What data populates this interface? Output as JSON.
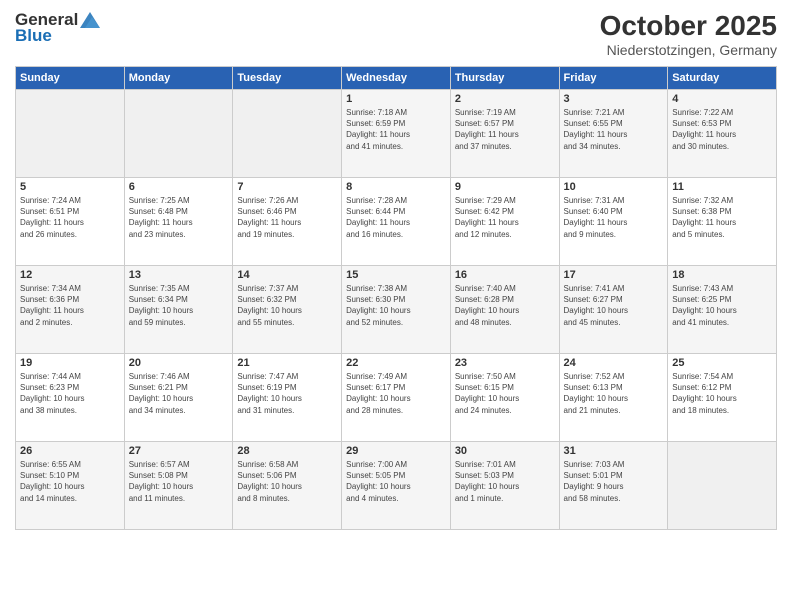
{
  "header": {
    "logo_general": "General",
    "logo_blue": "Blue",
    "month_title": "October 2025",
    "location": "Niederstotzingen, Germany"
  },
  "weekdays": [
    "Sunday",
    "Monday",
    "Tuesday",
    "Wednesday",
    "Thursday",
    "Friday",
    "Saturday"
  ],
  "weeks": [
    [
      {
        "day": "",
        "info": ""
      },
      {
        "day": "",
        "info": ""
      },
      {
        "day": "",
        "info": ""
      },
      {
        "day": "1",
        "info": "Sunrise: 7:18 AM\nSunset: 6:59 PM\nDaylight: 11 hours\nand 41 minutes."
      },
      {
        "day": "2",
        "info": "Sunrise: 7:19 AM\nSunset: 6:57 PM\nDaylight: 11 hours\nand 37 minutes."
      },
      {
        "day": "3",
        "info": "Sunrise: 7:21 AM\nSunset: 6:55 PM\nDaylight: 11 hours\nand 34 minutes."
      },
      {
        "day": "4",
        "info": "Sunrise: 7:22 AM\nSunset: 6:53 PM\nDaylight: 11 hours\nand 30 minutes."
      }
    ],
    [
      {
        "day": "5",
        "info": "Sunrise: 7:24 AM\nSunset: 6:51 PM\nDaylight: 11 hours\nand 26 minutes."
      },
      {
        "day": "6",
        "info": "Sunrise: 7:25 AM\nSunset: 6:48 PM\nDaylight: 11 hours\nand 23 minutes."
      },
      {
        "day": "7",
        "info": "Sunrise: 7:26 AM\nSunset: 6:46 PM\nDaylight: 11 hours\nand 19 minutes."
      },
      {
        "day": "8",
        "info": "Sunrise: 7:28 AM\nSunset: 6:44 PM\nDaylight: 11 hours\nand 16 minutes."
      },
      {
        "day": "9",
        "info": "Sunrise: 7:29 AM\nSunset: 6:42 PM\nDaylight: 11 hours\nand 12 minutes."
      },
      {
        "day": "10",
        "info": "Sunrise: 7:31 AM\nSunset: 6:40 PM\nDaylight: 11 hours\nand 9 minutes."
      },
      {
        "day": "11",
        "info": "Sunrise: 7:32 AM\nSunset: 6:38 PM\nDaylight: 11 hours\nand 5 minutes."
      }
    ],
    [
      {
        "day": "12",
        "info": "Sunrise: 7:34 AM\nSunset: 6:36 PM\nDaylight: 11 hours\nand 2 minutes."
      },
      {
        "day": "13",
        "info": "Sunrise: 7:35 AM\nSunset: 6:34 PM\nDaylight: 10 hours\nand 59 minutes."
      },
      {
        "day": "14",
        "info": "Sunrise: 7:37 AM\nSunset: 6:32 PM\nDaylight: 10 hours\nand 55 minutes."
      },
      {
        "day": "15",
        "info": "Sunrise: 7:38 AM\nSunset: 6:30 PM\nDaylight: 10 hours\nand 52 minutes."
      },
      {
        "day": "16",
        "info": "Sunrise: 7:40 AM\nSunset: 6:28 PM\nDaylight: 10 hours\nand 48 minutes."
      },
      {
        "day": "17",
        "info": "Sunrise: 7:41 AM\nSunset: 6:27 PM\nDaylight: 10 hours\nand 45 minutes."
      },
      {
        "day": "18",
        "info": "Sunrise: 7:43 AM\nSunset: 6:25 PM\nDaylight: 10 hours\nand 41 minutes."
      }
    ],
    [
      {
        "day": "19",
        "info": "Sunrise: 7:44 AM\nSunset: 6:23 PM\nDaylight: 10 hours\nand 38 minutes."
      },
      {
        "day": "20",
        "info": "Sunrise: 7:46 AM\nSunset: 6:21 PM\nDaylight: 10 hours\nand 34 minutes."
      },
      {
        "day": "21",
        "info": "Sunrise: 7:47 AM\nSunset: 6:19 PM\nDaylight: 10 hours\nand 31 minutes."
      },
      {
        "day": "22",
        "info": "Sunrise: 7:49 AM\nSunset: 6:17 PM\nDaylight: 10 hours\nand 28 minutes."
      },
      {
        "day": "23",
        "info": "Sunrise: 7:50 AM\nSunset: 6:15 PM\nDaylight: 10 hours\nand 24 minutes."
      },
      {
        "day": "24",
        "info": "Sunrise: 7:52 AM\nSunset: 6:13 PM\nDaylight: 10 hours\nand 21 minutes."
      },
      {
        "day": "25",
        "info": "Sunrise: 7:54 AM\nSunset: 6:12 PM\nDaylight: 10 hours\nand 18 minutes."
      }
    ],
    [
      {
        "day": "26",
        "info": "Sunrise: 6:55 AM\nSunset: 5:10 PM\nDaylight: 10 hours\nand 14 minutes."
      },
      {
        "day": "27",
        "info": "Sunrise: 6:57 AM\nSunset: 5:08 PM\nDaylight: 10 hours\nand 11 minutes."
      },
      {
        "day": "28",
        "info": "Sunrise: 6:58 AM\nSunset: 5:06 PM\nDaylight: 10 hours\nand 8 minutes."
      },
      {
        "day": "29",
        "info": "Sunrise: 7:00 AM\nSunset: 5:05 PM\nDaylight: 10 hours\nand 4 minutes."
      },
      {
        "day": "30",
        "info": "Sunrise: 7:01 AM\nSunset: 5:03 PM\nDaylight: 10 hours\nand 1 minute."
      },
      {
        "day": "31",
        "info": "Sunrise: 7:03 AM\nSunset: 5:01 PM\nDaylight: 9 hours\nand 58 minutes."
      },
      {
        "day": "",
        "info": ""
      }
    ]
  ]
}
